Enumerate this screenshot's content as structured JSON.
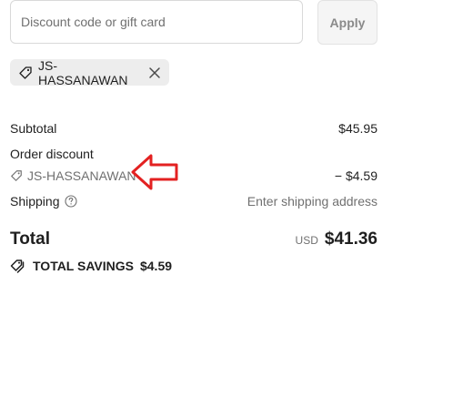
{
  "discount": {
    "placeholder": "Discount code or gift card",
    "apply_label": "Apply",
    "applied_code": "JS-HASSANAWAN",
    "applied_icon": "tag-icon",
    "remove_icon": "close-icon"
  },
  "summary": {
    "subtotal_label": "Subtotal",
    "subtotal_value": "$45.95",
    "order_discount_label": "Order discount",
    "discount_code": "JS-HASSANAWAN",
    "discount_value": "− $4.59",
    "shipping_label": "Shipping",
    "shipping_value": "Enter shipping address",
    "shipping_help_icon": "question-circle-icon"
  },
  "total": {
    "label": "Total",
    "currency": "USD",
    "amount": "$41.36"
  },
  "savings": {
    "label": "TOTAL SAVINGS",
    "amount": "$4.59",
    "icon": "tags-icon"
  },
  "annotation": {
    "arrow_color": "#e32121",
    "arrow_direction": "left"
  }
}
